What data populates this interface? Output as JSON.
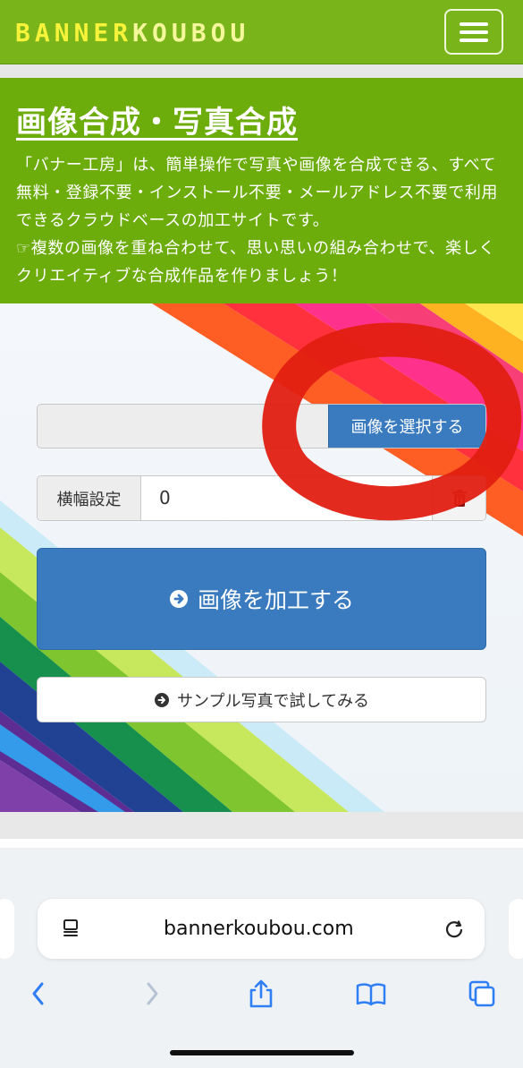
{
  "header": {
    "logo_part1": "BANNER",
    "logo_part2": "KOUBOU",
    "menu_icon": "hamburger-icon"
  },
  "intro": {
    "title": "画像合成・写真合成",
    "description": "「バナー工房」は、簡単操作で写真や画像を合成できる、すべて無料・登録不要・インストール不要・メールアドレス不要で利用できるクラウドベースの加工サイトです。",
    "tip": "複数の画像を重ね合わせて、思い思いの組み合わせで、楽しくクリエイティブな合成作品を作りましょう！"
  },
  "form": {
    "file_button": "画像を選択する",
    "width_label": "横幅設定",
    "width_value": "0",
    "process_button": "画像を加工する",
    "sample_button": "サンプル写真で試してみる"
  },
  "browser": {
    "url": "bannerkoubou.com",
    "reader_icon": "reader-icon",
    "reload_icon": "reload-icon",
    "toolbar": [
      "back-icon",
      "forward-icon",
      "share-icon",
      "bookmarks-icon",
      "tabs-icon"
    ]
  },
  "colors": {
    "brand_green": "#79b51a",
    "section_green": "#6cac0b",
    "primary_blue": "#3a7bbf",
    "annotation_red": "#e21f12",
    "ios_blue": "#2f7ef6"
  }
}
